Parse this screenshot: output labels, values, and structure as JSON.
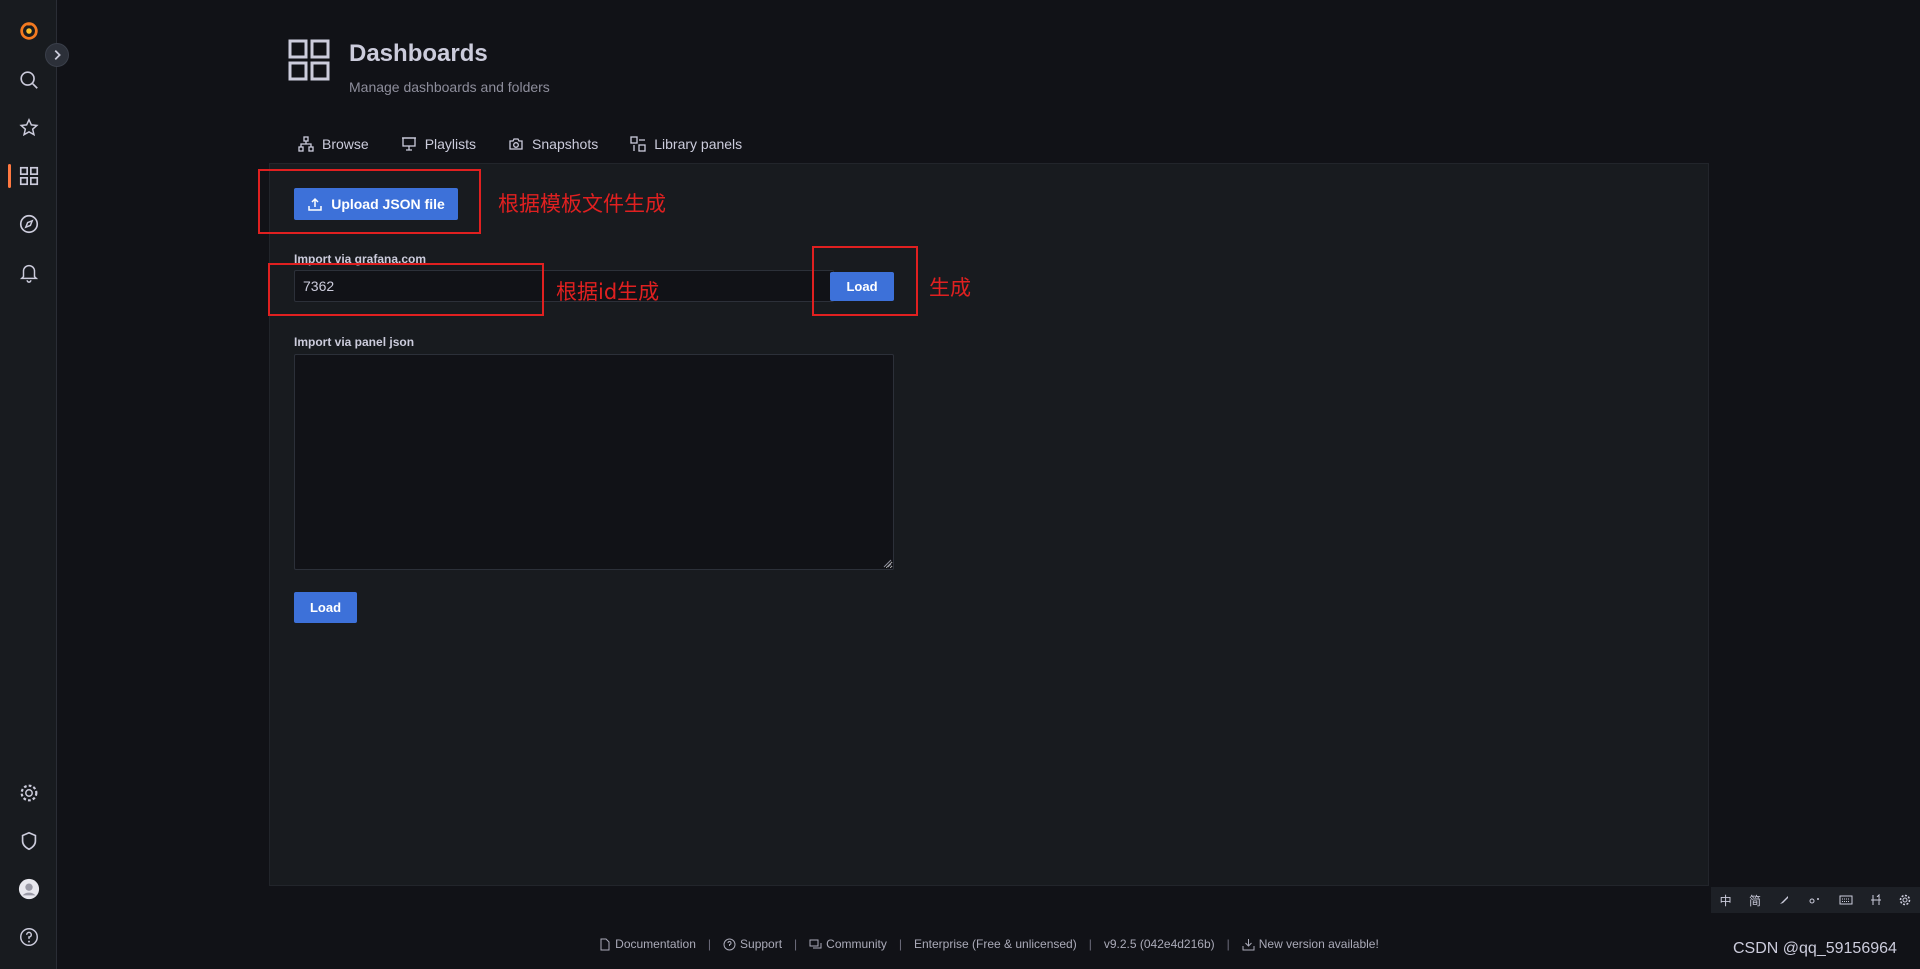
{
  "header": {
    "title": "Dashboards",
    "subtitle": "Manage dashboards and folders"
  },
  "tabs": [
    {
      "label": "Browse",
      "icon": "sitemap-icon"
    },
    {
      "label": "Playlists",
      "icon": "presentation-icon"
    },
    {
      "label": "Snapshots",
      "icon": "camera-icon"
    },
    {
      "label": "Library panels",
      "icon": "library-panels-icon"
    }
  ],
  "import": {
    "upload_label": "Upload JSON file",
    "grafana_label": "Import via grafana.com",
    "grafana_value": "7362",
    "load_label": "Load",
    "panel_json_label": "Import via panel json",
    "panel_json_value": "",
    "load_label_2": "Load"
  },
  "annotations": {
    "upload": "根据模板文件生成",
    "id": "根据id生成",
    "load": "生成"
  },
  "footer": {
    "documentation": "Documentation",
    "support": "Support",
    "community": "Community",
    "edition": "Enterprise (Free & unlicensed)",
    "version": "v9.2.5 (042e4d216b)",
    "new_version": "New version available!"
  },
  "ime": {
    "zh": "中",
    "jian": "简"
  },
  "watermark": "CSDN @qq_59156964",
  "colors": {
    "accent": "#3d71d9",
    "active": "#ff7941",
    "annotation": "#e02020"
  }
}
